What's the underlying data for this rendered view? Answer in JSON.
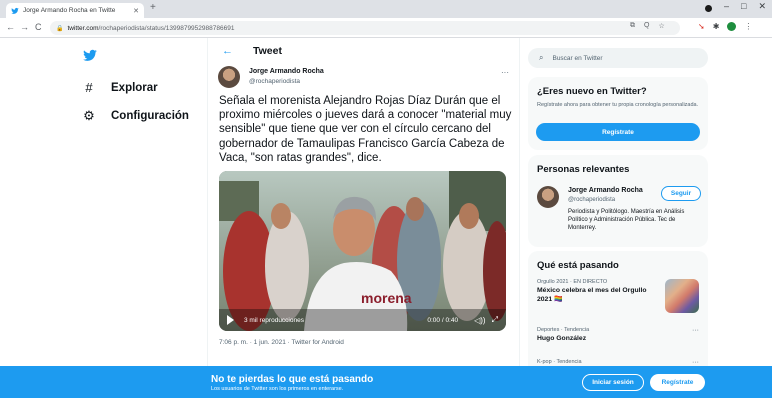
{
  "browser": {
    "tab_title": "Jorge Armando Rocha en Twitte",
    "tab_close": "✕",
    "new_tab": "+",
    "url_domain": "twitter.com",
    "url_path": "/rochaperiodista/status/1399879952988786691",
    "nav_back": "←",
    "nav_forward": "→",
    "nav_reload": "C",
    "omni_icons": [
      "⧉",
      "Q",
      "☆"
    ],
    "window_controls": [
      "–",
      "□",
      "✕"
    ]
  },
  "nav": {
    "items": [
      {
        "icon": "#",
        "label": "Explorar"
      },
      {
        "icon": "⚙",
        "label": "Configuración"
      }
    ]
  },
  "header": {
    "back": "←",
    "title": "Tweet"
  },
  "tweet": {
    "author_name": "Jorge Armando Rocha",
    "author_handle": "@rochaperiodista",
    "more": "···",
    "text": "Señala el morenista Alejandro Rojas Díaz Durán que el proximo miércoles o jueves dará a conocer \"material muy sensible\" que tiene que ver con el círculo cercano del gobernador de Tamaulipas Francisco García Cabeza de Vaca, \"son ratas grandes\", dice.",
    "video": {
      "views": "3 mil reproducciones",
      "duration": "0:00 / 0:40",
      "shirt_text": "morena",
      "volume": "◁))",
      "fullscreen": "⤢"
    },
    "meta": "7:06 p. m. · 1 jun. 2021 · Twitter for Android"
  },
  "sidebar": {
    "search_placeholder": "Buscar en Twitter",
    "search_icon": "⌕",
    "new_card": {
      "title": "¿Eres nuevo en Twitter?",
      "description": "Regístrate ahora para obtener tu propia cronología personalizada.",
      "signup_label": "Regístrate"
    },
    "relevant": {
      "title": "Personas relevantes",
      "name": "Jorge Armando Rocha",
      "handle": "@rochaperiodista",
      "follow_label": "Seguir",
      "bio": "Periodista y Politólogo. Maestría en Análisis Político y Administración Pública. Tec de Monterrey."
    },
    "trends": {
      "title": "Qué está pasando",
      "items": [
        {
          "context": "Orgullo 2021 · EN DIRECTO",
          "name": "México celebra el mes del Orgullo 2021 🏳️‍🌈"
        },
        {
          "context": "Deportes · Tendencia",
          "name": "Hugo González",
          "more": "···"
        },
        {
          "context": "K-pop · Tendencia",
          "name": "",
          "more": "···"
        }
      ]
    }
  },
  "bottom_bar": {
    "title": "No te pierdas lo que está pasando",
    "subtitle": "Los usuarios de Twitter son los primeros en enterarse.",
    "login_label": "Iniciar sesión",
    "signup_label": "Regístrate"
  },
  "colors": {
    "twitter_blue": "#1d9bf0",
    "text": "#0f1419",
    "muted": "#536471"
  }
}
